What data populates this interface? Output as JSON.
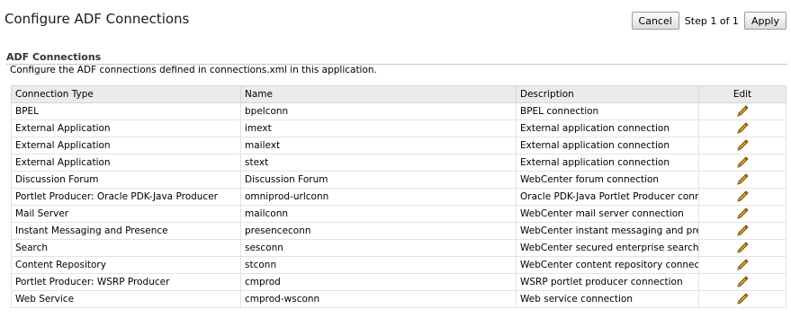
{
  "header": {
    "title": "Configure ADF Connections",
    "cancel_label": "Cancel",
    "step_text": "Step 1 of 1",
    "apply_label": "Apply"
  },
  "section": {
    "title": "ADF Connections",
    "description": "Configure the ADF connections defined in connections.xml in this application."
  },
  "table": {
    "columns": [
      "Connection Type",
      "Name",
      "Description",
      "Edit"
    ],
    "rows": [
      {
        "type": "BPEL",
        "name": "bpelconn",
        "description": "BPEL connection",
        "edit_icon": "pencil-icon"
      },
      {
        "type": "External Application",
        "name": "imext",
        "description": "External application connection",
        "edit_icon": "pencil-icon"
      },
      {
        "type": "External Application",
        "name": "mailext",
        "description": "External application connection",
        "edit_icon": "pencil-icon"
      },
      {
        "type": "External Application",
        "name": "stext",
        "description": "External application connection",
        "edit_icon": "pencil-icon"
      },
      {
        "type": "Discussion Forum",
        "name": "Discussion Forum",
        "description": "WebCenter forum connection",
        "edit_icon": "pencil-icon"
      },
      {
        "type": "Portlet Producer: Oracle PDK-Java Producer",
        "name": "omniprod-urlconn",
        "description": "Oracle PDK-Java Portlet Producer connect",
        "edit_icon": "pencil-icon"
      },
      {
        "type": "Mail Server",
        "name": "mailconn",
        "description": "WebCenter mail server connection",
        "edit_icon": "pencil-icon"
      },
      {
        "type": "Instant Messaging and Presence",
        "name": "presenceconn",
        "description": "WebCenter instant messaging and preser",
        "edit_icon": "pencil-icon"
      },
      {
        "type": "Search",
        "name": "sesconn",
        "description": "WebCenter secured enterprise search cor",
        "edit_icon": "pencil-icon"
      },
      {
        "type": "Content Repository",
        "name": "stconn",
        "description": "WebCenter content repository connection",
        "edit_icon": "pencil-icon"
      },
      {
        "type": "Portlet Producer: WSRP Producer",
        "name": "cmprod",
        "description": "WSRP portlet producer connection",
        "edit_icon": "pencil-icon"
      },
      {
        "type": "Web Service",
        "name": "cmprod-wsconn",
        "description": "Web service connection",
        "edit_icon": "pencil-icon"
      }
    ]
  },
  "colors": {
    "header_bg": "#ebebeb",
    "border": "#d6d6d6",
    "pencil_body": "#e0a020",
    "pencil_outline": "#5a3a00"
  }
}
